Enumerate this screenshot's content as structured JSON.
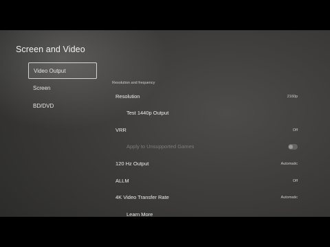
{
  "page": {
    "title": "Screen and Video"
  },
  "sidebar": {
    "items": [
      {
        "label": "Video Output",
        "selected": true
      },
      {
        "label": "Screen",
        "selected": false
      },
      {
        "label": "BD/DVD",
        "selected": false
      }
    ]
  },
  "content": {
    "section_heading": "Resolution and frequency",
    "resolution": {
      "label": "Resolution",
      "value": "2160p"
    },
    "test_1440p": {
      "label": "Test 1440p Output"
    },
    "vrr": {
      "label": "VRR",
      "value": "Off"
    },
    "apply_unsupported": {
      "label": "Apply to Unsupported Games",
      "value": "Off",
      "enabled": false
    },
    "hz120": {
      "label": "120 Hz Output",
      "value": "Automatic"
    },
    "allm": {
      "label": "ALLM",
      "value": "Off"
    },
    "transfer_rate": {
      "label": "4K Video Transfer Rate",
      "value": "Automatic"
    },
    "learn_more": {
      "label": "Learn More"
    }
  },
  "colors": {
    "background": "#3e3d3b",
    "text": "#e6e6e6",
    "disabled_text": "#7c7c7a"
  }
}
